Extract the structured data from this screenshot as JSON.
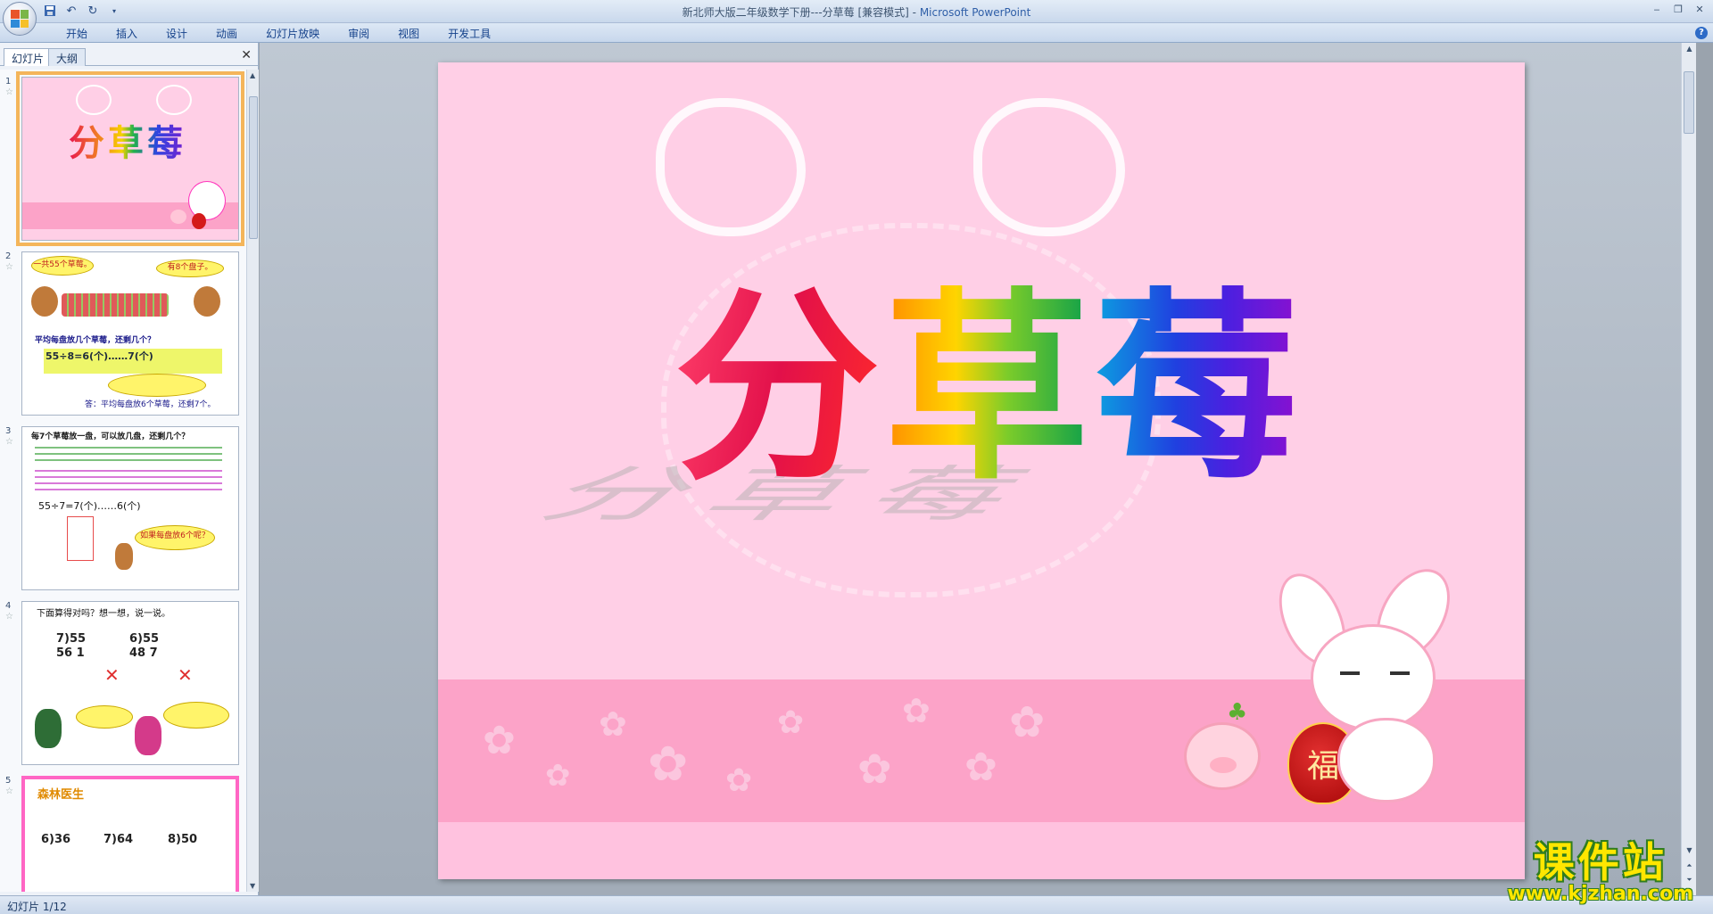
{
  "window": {
    "title_doc": "新北师大版二年级数学下册---分草莓 [兼容模式] - ",
    "title_app": "Microsoft PowerPoint"
  },
  "ribbon": {
    "tabs": [
      "开始",
      "插入",
      "设计",
      "动画",
      "幻灯片放映",
      "审阅",
      "视图",
      "开发工具"
    ]
  },
  "left_pane": {
    "tab_slides": "幻灯片",
    "tab_outline": "大纲",
    "slide_numbers": [
      "1",
      "2",
      "3",
      "4",
      "5"
    ]
  },
  "thumbnails": {
    "s1_title": "分草莓",
    "s2_bubble1": "一共55个草莓。",
    "s2_bubble2": "有8个盘子。",
    "s2_question": "平均每盘放几个草莓，还剩几个？",
    "s2_equation": "55÷8=6(个)……7(个)",
    "s2_answer": "答：平均每盘放6个草莓，还剩7个。",
    "s3_question": "每7个草莓放一盘，可以放几盘，还剩几个？",
    "s3_equation": "55÷7=7(个)……6(个)",
    "s3_bubble": "如果每盘放6个呢？",
    "s4_question": "下面算得对吗？想一想，说一说。",
    "s4_calc1": "7)55 56 1",
    "s4_calc2": "6)55 48 7",
    "s5_title": "森林医生",
    "s5_calc": [
      "6)36",
      "7)64",
      "8)50"
    ]
  },
  "slide": {
    "title_chars": [
      "分",
      "草",
      "莓"
    ],
    "pig_label": "福"
  },
  "status": {
    "text": "幻灯片 1/12"
  },
  "watermark": {
    "title": "课件站",
    "url": "www.kjzhan.com"
  },
  "colors": {
    "slide_bg": "#ffcfe6",
    "stripe": "#fca3c8",
    "selection": "#f4b55a"
  }
}
